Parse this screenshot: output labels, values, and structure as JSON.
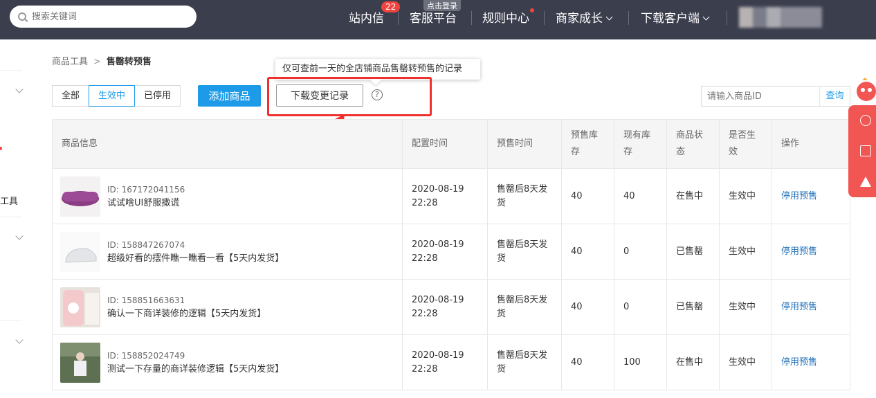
{
  "topbar": {
    "search_placeholder": "搜索关键词",
    "nav": {
      "messages": "站内信",
      "messages_badge": "22",
      "service": "客服平台",
      "service_tip": "点击登录",
      "rules": "规则中心",
      "growth": "商家成长",
      "download_client": "下载客户端"
    }
  },
  "sidebar": {
    "partial_label": "工具"
  },
  "breadcrumb": {
    "parent": "商品工具",
    "separator": ">",
    "current": "售罄转预售"
  },
  "filters": {
    "tabs": [
      "全部",
      "生效中",
      "已停用"
    ],
    "active_tab": "生效中"
  },
  "actions": {
    "add_product": "添加商品",
    "download_log": "下载变更记录",
    "help_symbol": "?",
    "tooltip": "仅可查前一天的全店铺商品售罄转预售的记录"
  },
  "id_search": {
    "placeholder": "请输入商品ID",
    "button": "查询"
  },
  "table": {
    "headers": {
      "product": "商品信息",
      "config_time": "配置时间",
      "presale_time": "预售时间",
      "presale_stock": "预售库存",
      "stock": "现有库存",
      "status": "商品状态",
      "effective": "是否生效",
      "op": "操作"
    },
    "rows": [
      {
        "id": "ID: 167172041156",
        "name": "试试啥UI舒服撒谎",
        "date": "2020-08-19",
        "time": "22:28",
        "presale": "售罄后8天发货",
        "presale_stock": "40",
        "stock": "40",
        "status": "在售中",
        "effective": "生效中",
        "op": "停用预售"
      },
      {
        "id": "ID: 158847267074",
        "name": "超级好看的摆件瞧一瞧看一看【5天内发货】",
        "date": "2020-08-19",
        "time": "22:28",
        "presale": "售罄后8天发货",
        "presale_stock": "40",
        "stock": "0",
        "status": "已售罄",
        "effective": "生效中",
        "op": "停用预售"
      },
      {
        "id": "ID: 158851663631",
        "name": "确认一下商详装修的逻辑【5天内发货】",
        "date": "2020-08-19",
        "time": "22:28",
        "presale": "售罄后8天发货",
        "presale_stock": "40",
        "stock": "0",
        "status": "已售罄",
        "effective": "生效中",
        "op": "停用预售"
      },
      {
        "id": "ID: 158852024749",
        "name": "测试一下存量的商详装修逻辑【5天内发货】",
        "date": "2020-08-19",
        "time": "22:28",
        "presale": "售罄后8天发货",
        "presale_stock": "40",
        "stock": "100",
        "status": "在售中",
        "effective": "生效中",
        "op": "停用预售"
      }
    ]
  },
  "colors": {
    "accent": "#1e9be8",
    "topbar": "#3b3e4d",
    "highlight_red": "#f0302c"
  }
}
